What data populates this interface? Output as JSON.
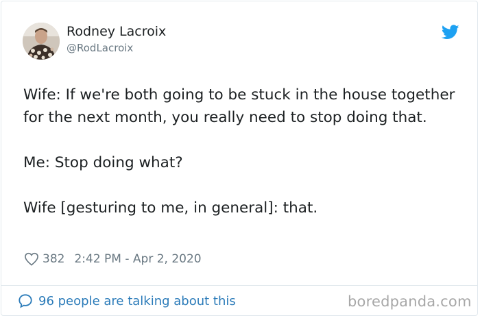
{
  "author": {
    "display_name": "Rodney Lacroix",
    "handle": "@RodLacroix"
  },
  "tweet": {
    "lines": [
      "Wife: If we're both going to be stuck in the house together for the next month, you really need to stop doing that.",
      "Me: Stop doing what?",
      "Wife [gesturing to me, in general]: that."
    ]
  },
  "meta": {
    "likes": "382",
    "timestamp": "2:42 PM - Apr 2, 2020",
    "heart_icon": "heart-outline-icon"
  },
  "footer": {
    "conversation_text": "96 people are talking about this",
    "conversation_icon": "speech-bubble-icon",
    "watermark": "boredpanda.com"
  },
  "colors": {
    "link": "#2b7bb9",
    "twitter_blue": "#1da1f2",
    "muted": "#697882",
    "border": "#e1e8ed"
  }
}
